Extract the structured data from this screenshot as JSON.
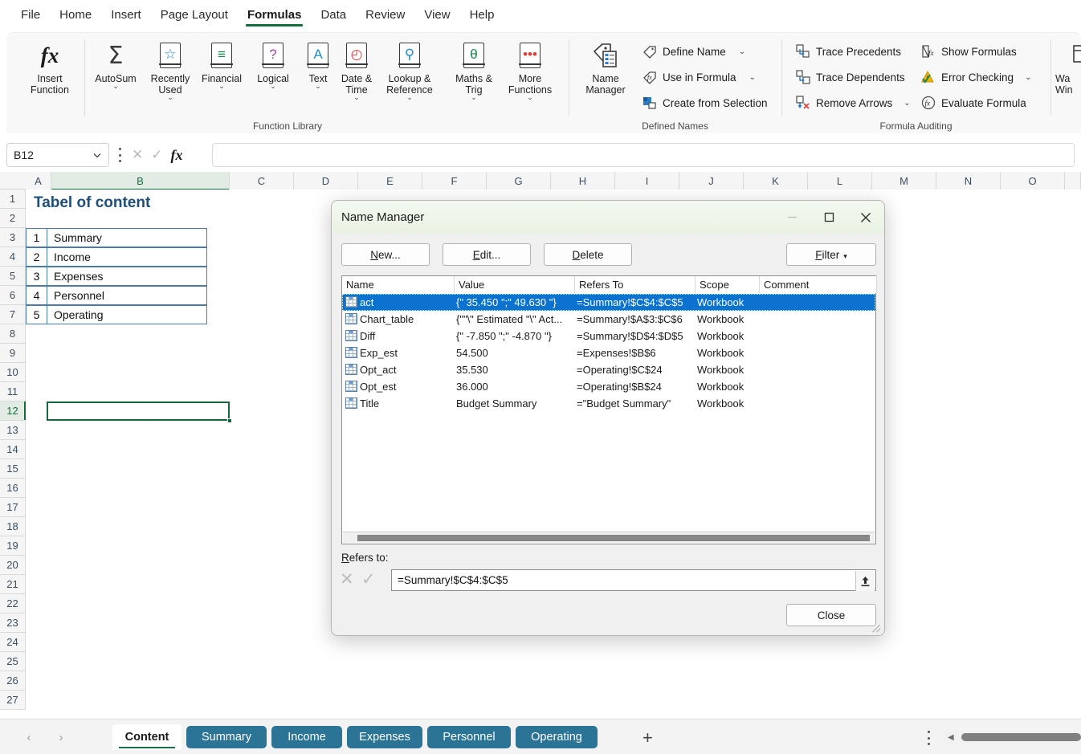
{
  "ribbon": {
    "tabs": [
      {
        "label": "File",
        "active": false
      },
      {
        "label": "Home",
        "active": false
      },
      {
        "label": "Insert",
        "active": false
      },
      {
        "label": "Page Layout",
        "active": false
      },
      {
        "label": "Formulas",
        "active": true
      },
      {
        "label": "Data",
        "active": false
      },
      {
        "label": "Review",
        "active": false
      },
      {
        "label": "View",
        "active": false
      },
      {
        "label": "Help",
        "active": false
      }
    ],
    "groups": {
      "function_library": {
        "label": "Function Library",
        "insert_function": "Insert\nFunction",
        "buttons": [
          {
            "label": "AutoSum",
            "icon": "sigma-icon",
            "sym": "Σ",
            "color": "#3a3a3a",
            "caret": true
          },
          {
            "label": "Recently\nUsed",
            "icon": "star-book-icon",
            "sym": "☆",
            "color": "#1d8bd1",
            "caret": true
          },
          {
            "label": "Financial",
            "icon": "coins-book-icon",
            "sym": "≡",
            "color": "#17874a",
            "caret": true
          },
          {
            "label": "Logical",
            "icon": "question-book-icon",
            "sym": "?",
            "color": "#a23fb0",
            "caret": true
          },
          {
            "label": "Text",
            "icon": "letter-a-book-icon",
            "sym": "A",
            "color": "#1d8bd1",
            "caret": true
          },
          {
            "label": "Date &\nTime",
            "icon": "clock-book-icon",
            "sym": "◴",
            "color": "#e03c3c",
            "caret": true
          },
          {
            "label": "Lookup &\nReference",
            "icon": "magnifier-book-icon",
            "sym": "⚲",
            "color": "#1d8bd1",
            "caret": true
          },
          {
            "label": "Maths &\nTrig",
            "icon": "theta-book-icon",
            "sym": "θ",
            "color": "#17874a",
            "caret": true
          },
          {
            "label": "More\nFunctions",
            "icon": "ellipsis-book-icon",
            "sym": "•••",
            "color": "#e03c3c",
            "caret": true
          }
        ]
      },
      "defined_names": {
        "label": "Defined Names",
        "name_manager": "Name\nManager",
        "items": [
          {
            "label": "Define Name",
            "icon": "tag-icon",
            "caret": true
          },
          {
            "label": "Use in Formula",
            "icon": "fx-tag-icon",
            "caret": true
          },
          {
            "label": "Create from Selection",
            "icon": "create-from-selection-icon",
            "caret": false
          }
        ]
      },
      "formula_auditing": {
        "label": "Formula Auditing",
        "items": [
          {
            "label": "Trace Precedents",
            "icon": "trace-precedents-icon",
            "caret": false
          },
          {
            "label": "Trace Dependents",
            "icon": "trace-dependents-icon",
            "caret": false
          },
          {
            "label": "Remove Arrows",
            "icon": "remove-arrows-icon",
            "caret": true
          },
          {
            "label": "Show Formulas",
            "icon": "show-formulas-icon",
            "caret": false
          },
          {
            "label": "Error Checking",
            "icon": "error-checking-icon",
            "caret": true
          },
          {
            "label": "Evaluate Formula",
            "icon": "evaluate-formula-icon",
            "caret": false
          }
        ]
      },
      "watch_window": {
        "label": "Wa",
        "label2": "Win"
      }
    }
  },
  "formula_bar": {
    "name_box_value": "B12",
    "cancel_icon": "✕",
    "confirm_icon": "✓",
    "fx_icon": "fx",
    "formula_value": ""
  },
  "grid": {
    "columns": [
      "A",
      "B",
      "C",
      "D",
      "E",
      "F",
      "G",
      "H",
      "I",
      "J",
      "K",
      "L",
      "M",
      "N",
      "O"
    ],
    "selected_column": "B",
    "rows": [
      1,
      2,
      3,
      4,
      5,
      6,
      7,
      8,
      9,
      10,
      11,
      12,
      13,
      14,
      15,
      16,
      17,
      18,
      19,
      20,
      21,
      22,
      23,
      24,
      25,
      26,
      27
    ],
    "selected_row": 12,
    "title_cell": "Tabel of content",
    "toc": [
      {
        "num": "1",
        "label": "Summary"
      },
      {
        "num": "2",
        "label": "Income"
      },
      {
        "num": "3",
        "label": "Expenses"
      },
      {
        "num": "4",
        "label": "Personnel"
      },
      {
        "num": "5",
        "label": "Operating"
      }
    ],
    "active_cell_ref": "B12"
  },
  "sheet_tabs": {
    "prev_icon": "‹",
    "next_icon": "›",
    "tabs": [
      {
        "label": "Content",
        "active": true
      },
      {
        "label": "Summary",
        "active": false
      },
      {
        "label": "Income",
        "active": false
      },
      {
        "label": "Expenses",
        "active": false
      },
      {
        "label": "Personnel",
        "active": false
      },
      {
        "label": "Operating",
        "active": false
      }
    ],
    "add_sheet_icon": "+"
  },
  "dialog": {
    "title": "Name Manager",
    "minimize_icon": "—",
    "maximize_icon": "☐",
    "close_icon": "✕",
    "toolbar": {
      "new": {
        "pre": "",
        "accel": "N",
        "post": "ew..."
      },
      "edit": {
        "pre": "",
        "accel": "E",
        "post": "dit..."
      },
      "delete": {
        "pre": "",
        "accel": "D",
        "post": "elete"
      },
      "filter": {
        "pre": "",
        "accel": "F",
        "post": "ilter",
        "caret": "▾"
      }
    },
    "columns": [
      "Name",
      "Value",
      "Refers To",
      "Scope",
      "Comment"
    ],
    "rows": [
      {
        "name": "act",
        "value": "{\" 35.450 \";\" 49.630 \"}",
        "refers_to": "=Summary!$C$4:$C$5",
        "scope": "Workbook",
        "comment": "",
        "selected": true
      },
      {
        "name": "Chart_table",
        "value": "{\"\"\\\" Estimated \"\\\" Act...",
        "refers_to": "=Summary!$A$3:$C$6",
        "scope": "Workbook",
        "comment": "",
        "selected": false
      },
      {
        "name": "Diff",
        "value": "{\" -7.850 \";\" -4.870 \"}",
        "refers_to": "=Summary!$D$4:$D$5",
        "scope": "Workbook",
        "comment": "",
        "selected": false
      },
      {
        "name": "Exp_est",
        "value": "54.500",
        "refers_to": "=Expenses!$B$6",
        "scope": "Workbook",
        "comment": "",
        "selected": false
      },
      {
        "name": "Opt_act",
        "value": "35.530",
        "refers_to": "=Operating!$C$24",
        "scope": "Workbook",
        "comment": "",
        "selected": false
      },
      {
        "name": "Opt_est",
        "value": "36.000",
        "refers_to": "=Operating!$B$24",
        "scope": "Workbook",
        "comment": "",
        "selected": false
      },
      {
        "name": "Title",
        "value": "Budget Summary",
        "refers_to": "=\"Budget Summary\"",
        "scope": "Workbook",
        "comment": "",
        "selected": false
      }
    ],
    "refers_to_label": {
      "accel": "R",
      "post": "efers to:"
    },
    "refers_to_value": "=Summary!$C$4:$C$5",
    "refers_to_cancel_icon": "✕",
    "refers_to_confirm_icon": "✓",
    "collapse_icon": "⬆",
    "close_label": "Close"
  },
  "colors": {
    "accent_green": "#126e3c",
    "tab_blue": "#2b7496",
    "selection_blue": "#0b72cf",
    "title_text": "#1f4e79"
  }
}
